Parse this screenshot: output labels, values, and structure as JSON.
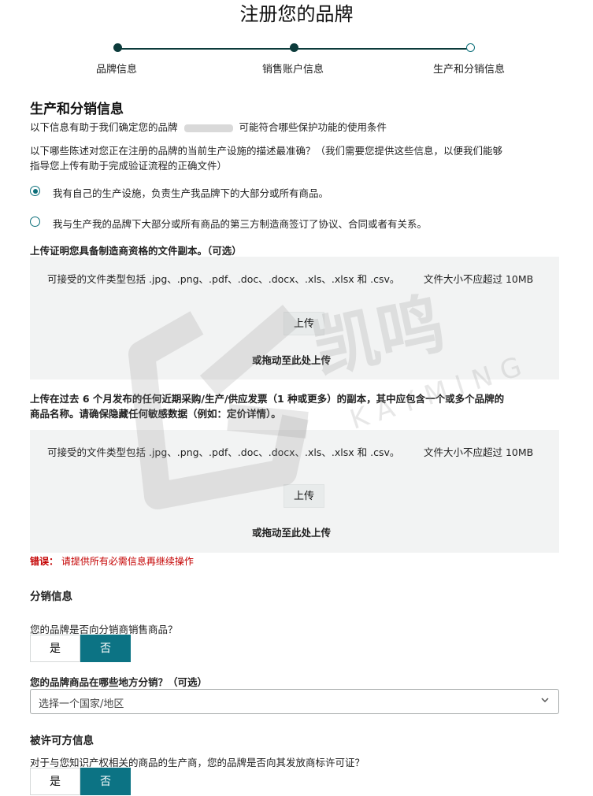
{
  "page_title": "注册您的品牌",
  "steps": [
    {
      "label": "品牌信息",
      "state": "done"
    },
    {
      "label": "销售账户信息",
      "state": "done"
    },
    {
      "label": "生产和分销信息",
      "state": "current"
    }
  ],
  "production": {
    "heading": "生产和分销信息",
    "intro_before": "以下信息有助于我们确定您的品牌",
    "intro_after": "可能符合哪些保护功能的使用条件",
    "question_line1": "以下哪些陈述对您正在注册的品牌的当前生产设施的描述最准确？（我们需要您提供这些信息，以便我们能够",
    "question_line2": "指导您上传有助于完成验证流程的正确文件）",
    "options": [
      {
        "label": "我有自己的生产设施，负责生产我品牌下的大部分或所有商品。",
        "selected": true
      },
      {
        "label": "我与生产我的品牌下大部分或所有商品的第三方制造商签订了协议、合同或者有关系。",
        "selected": false
      }
    ]
  },
  "upload1": {
    "label": "上传证明您具备制造商资格的文件副本。（可选）",
    "file_types": "可接受的文件类型包括 .jpg、.png、.pdf、.doc、.docx、.xls、.xlsx 和 .csv。",
    "size_limit": "文件大小不应超过 10MB",
    "button": "上传",
    "drag_text": "或拖动至此处上传"
  },
  "upload2": {
    "label_line1": "上传在过去 6 个月发布的任何近期采购/生产/供应发票（1 种或更多）的副本，其中应包含一个或多个品牌的",
    "label_line2": "商品名称。请确保隐藏任何敏感数据（例如：定价详情）。",
    "file_types": "可接受的文件类型包括 .jpg、.png、.pdf、.doc、.docx、.xls、.xlsx 和 .csv。",
    "size_limit": "文件大小不应超过 10MB",
    "button": "上传",
    "drag_text": "或拖动至此处上传"
  },
  "error": {
    "prefix": "错误：",
    "message": "请提供所有必需信息再继续操作"
  },
  "distribution": {
    "heading": "分销信息",
    "question": "您的品牌是否向分销商销售商品？",
    "yes": "是",
    "no": "否",
    "selected": "否",
    "where_label": "您的品牌商品在哪些地方分销？（可选）",
    "select_placeholder": "选择一个国家/地区"
  },
  "licensee": {
    "heading": "被许可方信息",
    "question": "对于与您知识产权相关的商品的生产商，您的品牌是否向其发放商标许可证？",
    "yes": "是",
    "no": "否",
    "selected": "否"
  },
  "watermark": {
    "text_cn": "凯鸣",
    "text_en": "KAYMING"
  },
  "colors": {
    "accent": "#0c7384",
    "stepper": "#0c3b3b",
    "error": "#c40000",
    "upload_bg": "#f2f3f3"
  }
}
